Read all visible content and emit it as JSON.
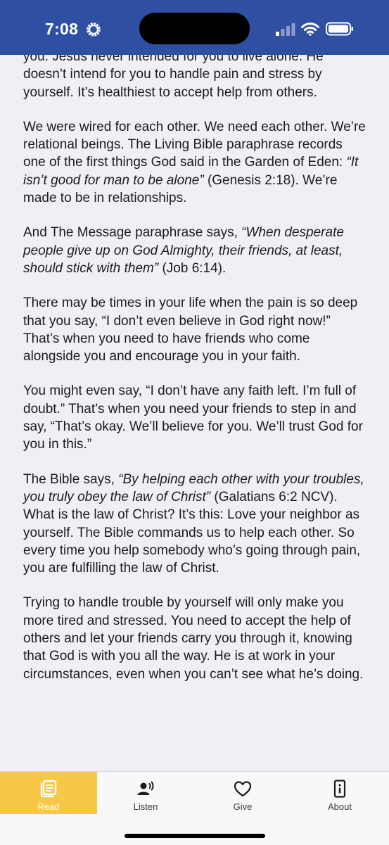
{
  "status_bar": {
    "time": "7:08",
    "icons": [
      "settings-gear-icon",
      "cellular-signal-icon",
      "wifi-icon",
      "battery-icon"
    ]
  },
  "article": {
    "paragraphs": [
      [
        {
          "text": "you. Jesus never intended for you to live alone. He doesn’t "
        },
        {
          "text": "intend for you to handle pain and stress by yourself. It’s healthiest to accept help from others."
        }
      ],
      [
        {
          "text": "We were wired for each other. We need each other. We’re relational beings. The Living Bible paraphrase records one of the first things God said in the Garden of Eden: "
        },
        {
          "text": "“It isn’t good for man to be alone”",
          "italic": true
        },
        {
          "text": " (Genesis 2:18). We’re made to be in relationships."
        }
      ],
      [
        {
          "text": "And The Message paraphrase says, "
        },
        {
          "text": "“When desperate people give up on God Almighty, their friends, at least, should stick with them”",
          "italic": true
        },
        {
          "text": " (Job 6:14)."
        }
      ],
      [
        {
          "text": "There may be times in your life when the pain is so deep that you say, “I don’t even believe in God right now!” That’s when you need to have friends who come alongside you and encourage you in your faith."
        }
      ],
      [
        {
          "text": "You might even say, “I don’t have any faith left. I’m full of doubt.” That’s when you need your friends to step in and say, “That’s okay. We’ll believe for you. We’ll trust God for you in this.”"
        }
      ],
      [
        {
          "text": "The Bible says, "
        },
        {
          "text": "“By helping each other with your troubles, you truly obey the law of Christ”",
          "italic": true
        },
        {
          "text": " (Galatians 6:2 NCV). What is the law of Christ? It’s this: Love your neighbor as yourself. The Bible commands us to help each other. So every time you help somebody who’s going through pain, you are fulfilling the law of Christ."
        }
      ],
      [
        {
          "text": "Trying to handle trouble by yourself will only make you more tired and stressed. You need to accept the help of others and let your friends carry you through it, knowing that God is with you all the way. He is at work in your circumstances, even when you can’t see what he’s doing."
        }
      ]
    ]
  },
  "tab_bar": {
    "active": "read",
    "tabs": [
      {
        "id": "read",
        "label": "Read",
        "icon": "book-icon"
      },
      {
        "id": "listen",
        "label": "Listen",
        "icon": "speaker-person-icon"
      },
      {
        "id": "give",
        "label": "Give",
        "icon": "heart-icon"
      },
      {
        "id": "about",
        "label": "About",
        "icon": "info-icon"
      }
    ]
  },
  "colors": {
    "status_bar_bg": "#2f4fa2",
    "page_bg": "#efeff4",
    "active_tab_bg": "#f7c748",
    "tab_bar_bg": "#f8f8fa"
  }
}
